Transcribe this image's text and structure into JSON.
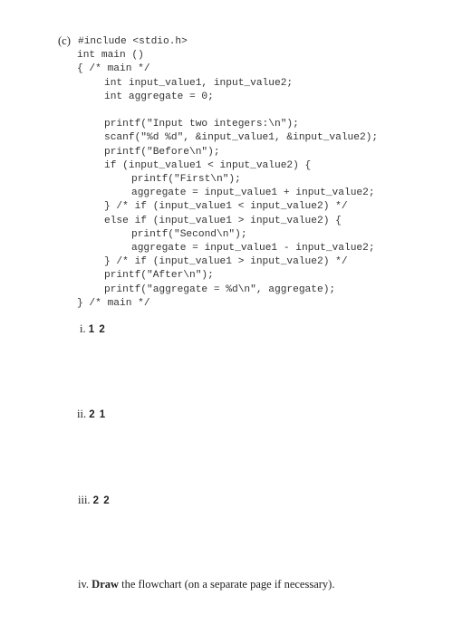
{
  "question": {
    "label": "(c)",
    "code_lines": [
      "#include <stdio.h>",
      "int main ()",
      "{ /* main */",
      "int input_value1, input_value2;",
      "int aggregate = 0;",
      "",
      "printf(\"Input two integers:\\n\");",
      "scanf(\"%d %d\", &input_value1, &input_value2);",
      "printf(\"Before\\n\");",
      "if (input_value1 < input_value2) {",
      "printf(\"First\\n\");",
      "aggregate = input_value1 + input_value2;",
      "} /* if (input_value1 < input_value2) */",
      "else if (input_value1 > input_value2) {",
      "printf(\"Second\\n\");",
      "aggregate = input_value1 - input_value2;",
      "} /* if (input_value1 > input_value2) */",
      "printf(\"After\\n\");",
      "printf(\"aggregate = %d\\n\", aggregate);",
      "} /* main */"
    ]
  },
  "subparts": [
    {
      "label": "i.",
      "input": "1 2"
    },
    {
      "label": "ii.",
      "input": "2 1"
    },
    {
      "label": "iii.",
      "input": "2 2"
    },
    {
      "label": "iv.",
      "bold_text": "Draw",
      "text": " the flowchart (on a separate page if necessary)."
    }
  ]
}
